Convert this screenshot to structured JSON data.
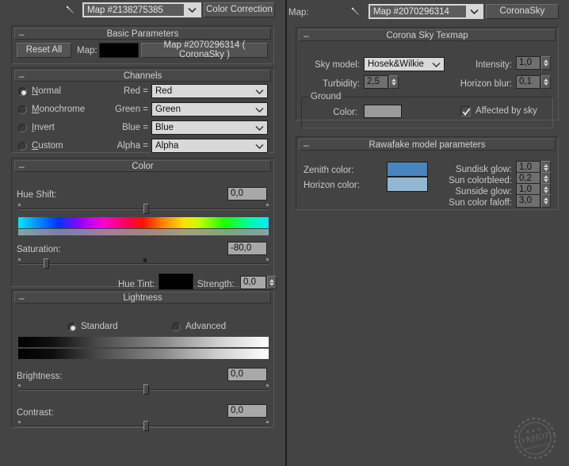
{
  "window": {
    "background": "#3f3f3f",
    "panel_bg": "#444444"
  },
  "left_panel": {
    "toolbar": {
      "eyedropper_icon": "eyedropper-icon",
      "map_name": "Map #2138275385",
      "type_button": "Color Correction"
    },
    "basic_parameters": {
      "title": "Basic Parameters",
      "collapse_glyph": "–",
      "reset_all": "Reset All",
      "map_label": "Map:",
      "map_swatch_color": "#000000",
      "map_button": "Map #2070296314  ( CoronaSky )"
    },
    "channels": {
      "title": "Channels",
      "collapse_glyph": "–",
      "modes": [
        {
          "label": "Normal",
          "mnemonic": "N",
          "selected": true
        },
        {
          "label": "Monochrome",
          "mnemonic": "M",
          "selected": false
        },
        {
          "label": "Invert",
          "mnemonic": "I",
          "selected": false
        },
        {
          "label": "Custom",
          "mnemonic": "C",
          "selected": false
        }
      ],
      "rows": [
        {
          "label": "Red =",
          "value": "Red"
        },
        {
          "label": "Green =",
          "value": "Green"
        },
        {
          "label": "Blue =",
          "value": "Blue"
        },
        {
          "label": "Alpha =",
          "value": "Alpha"
        }
      ]
    },
    "color": {
      "title": "Color",
      "collapse_glyph": "–",
      "hue_shift_label": "Hue Shift:",
      "hue_shift_value": "0,0",
      "hue_shift_pos_pct": 50,
      "saturation_label": "Saturation:",
      "saturation_value": "-80,0",
      "saturation_pos_pct": 10,
      "saturation_mid_pct": 50,
      "hue_tint_label": "Hue Tint:",
      "hue_tint_color": "#000000",
      "strength_label": "Strength:",
      "strength_value": "0,0"
    },
    "lightness": {
      "title": "Lightness",
      "collapse_glyph": "–",
      "modes": [
        {
          "label": "Standard",
          "selected": true
        },
        {
          "label": "Advanced",
          "selected": false
        }
      ],
      "brightness_label": "Brightness:",
      "brightness_value": "0,0",
      "brightness_pos_pct": 50,
      "contrast_label": "Contrast:",
      "contrast_value": "0,0",
      "contrast_pos_pct": 50
    }
  },
  "right_panel": {
    "toolbar": {
      "map_label": "Map:",
      "eyedropper_icon": "eyedropper-icon",
      "map_name": "Map #2070296314",
      "type_button": "CoronaSky"
    },
    "sky_texmap": {
      "title": "Corona Sky Texmap",
      "collapse_glyph": "–",
      "sky_model_label": "Sky model:",
      "sky_model_value": "Hosek&Wilkie",
      "turbidity_label": "Turbidity:",
      "turbidity_value": "2,5",
      "intensity_label": "Intensity:",
      "intensity_value": "1,0",
      "horizon_blur_label": "Horizon blur:",
      "horizon_blur_value": "0,1",
      "ground_group": "Ground",
      "ground_color_label": "Color:",
      "ground_color": "#9a9a9a",
      "affected_by_sky_label": "Affected by sky",
      "affected_by_sky_checked": true
    },
    "rawafake": {
      "title": "Rawafake model parameters",
      "collapse_glyph": "–",
      "zenith_color_label": "Zenith color:",
      "zenith_color": "#4884bd",
      "horizon_color_label": "Horizon color:",
      "horizon_color": "#90b8d2",
      "params": [
        {
          "label": "Sundisk glow:",
          "value": "1,0"
        },
        {
          "label": "Sun colorbleed:",
          "value": "0,2"
        },
        {
          "label": "Sunside glow:",
          "value": "1,0"
        },
        {
          "label": "Sun color faloff:",
          "value": "3,0"
        }
      ]
    }
  },
  "watermark": {
    "text": "VKHOT",
    "sub": "www.vkhot.com"
  }
}
